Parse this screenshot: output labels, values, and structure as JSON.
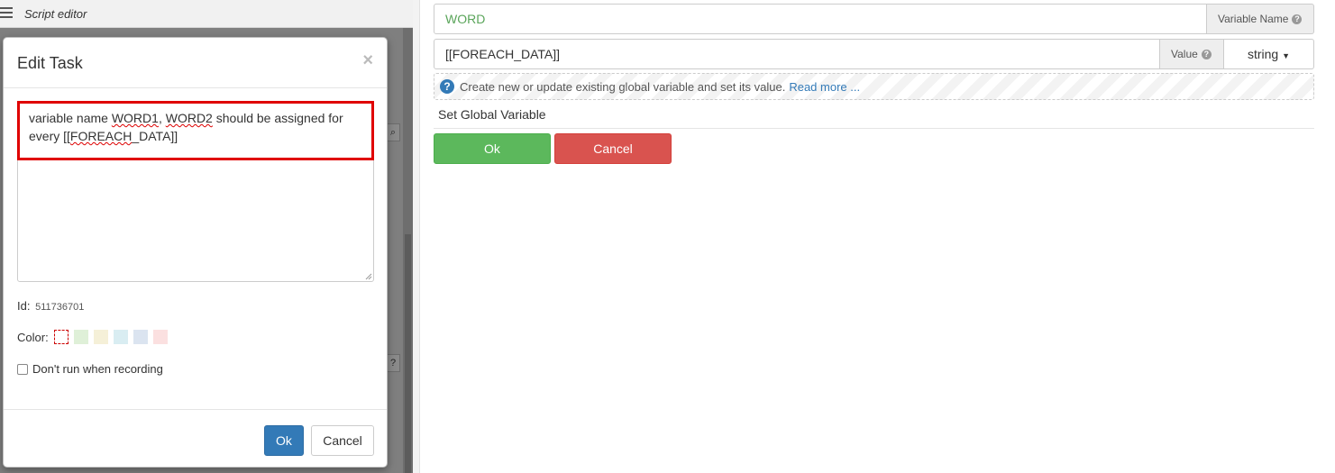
{
  "editor": {
    "title": "Script editor"
  },
  "modal": {
    "title": "Edit Task",
    "close_label": "×",
    "task_text": {
      "part1": "variable name ",
      "word1": "WORD1",
      "comma": ", ",
      "word2": "WORD2",
      "part2": " should be assigned for every [[",
      "foreach": "FOREACH",
      "part3": "_DATA]]"
    },
    "id_label": "Id:",
    "id_value": "511736701",
    "color_label": "Color:",
    "colors": [
      "#ffffff",
      "#dff0d8",
      "#f5f0d8",
      "#d9edf2",
      "#dbe4f0",
      "#fbe0e0"
    ],
    "dont_run_label": "Don't run when recording",
    "ok_label": "Ok",
    "cancel_label": "Cancel"
  },
  "variable": {
    "name_value": "WORD",
    "name_addon": "Variable Name",
    "value_value": "[[FOREACH_DATA]]",
    "value_addon": "Value",
    "type_selected": "string",
    "info_text": "Create new or update existing global variable and set its value.",
    "read_more": "Read more ..."
  },
  "action": {
    "name": "Set Global Variable",
    "ok_label": "Ok",
    "cancel_label": "Cancel"
  },
  "accent_colors": {
    "primary": "#337ab7",
    "success": "#5cb85c",
    "danger": "#d9534f",
    "highlight": "#e00000"
  }
}
